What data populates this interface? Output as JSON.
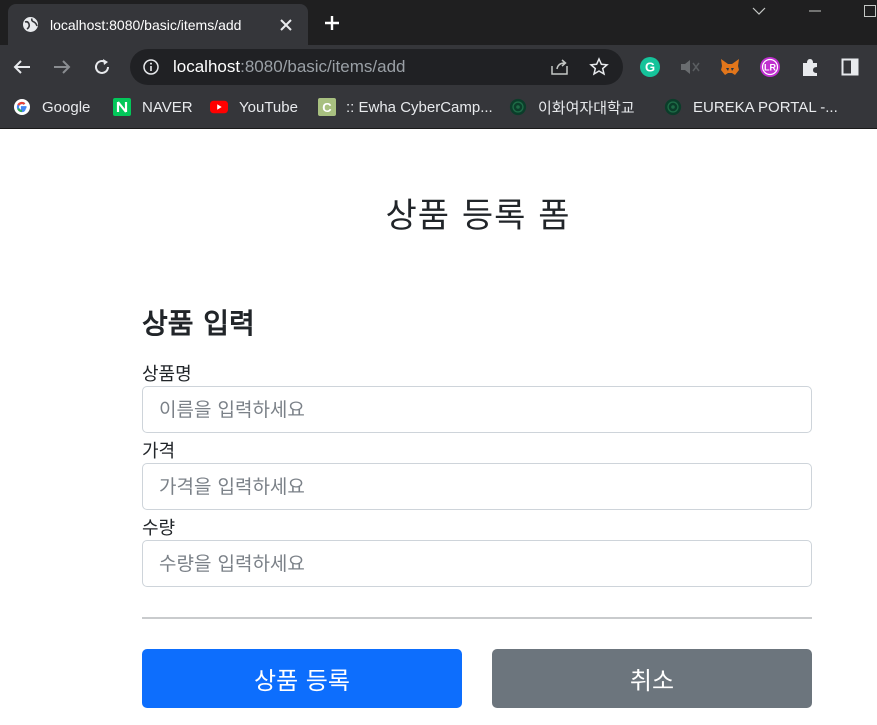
{
  "browser": {
    "tab_title": "localhost:8080/basic/items/add",
    "url_host": "localhost",
    "url_path": ":8080/basic/items/add",
    "bookmarks": [
      {
        "label": "Google",
        "icon": "google-icon"
      },
      {
        "label": "NAVER",
        "icon": "naver-icon"
      },
      {
        "label": "YouTube",
        "icon": "youtube-icon"
      },
      {
        "label": ":: Ewha CyberCamp...",
        "icon": "cybercampus-icon"
      },
      {
        "label": "이화여자대학교",
        "icon": "ewha-icon"
      },
      {
        "label": "EUREKA PORTAL -...",
        "icon": "eureka-icon"
      }
    ],
    "extensions": [
      "grammarly-icon",
      "mute-icon",
      "metamask-icon",
      "lr-icon",
      "puzzle-icon",
      "sidepanel-icon"
    ]
  },
  "page": {
    "title": "상품 등록 폼",
    "section_title": "상품 입력",
    "fields": [
      {
        "label": "상품명",
        "placeholder": "이름을 입력하세요",
        "value": ""
      },
      {
        "label": "가격",
        "placeholder": "가격을 입력하세요",
        "value": ""
      },
      {
        "label": "수량",
        "placeholder": "수량을 입력하세요",
        "value": ""
      }
    ],
    "submit_label": "상품 등록",
    "cancel_label": "취소"
  },
  "colors": {
    "primary": "#0d6efd",
    "secondary": "#6c757d",
    "chrome_dark": "#1f1f20",
    "chrome_toolbar": "#35363a"
  }
}
